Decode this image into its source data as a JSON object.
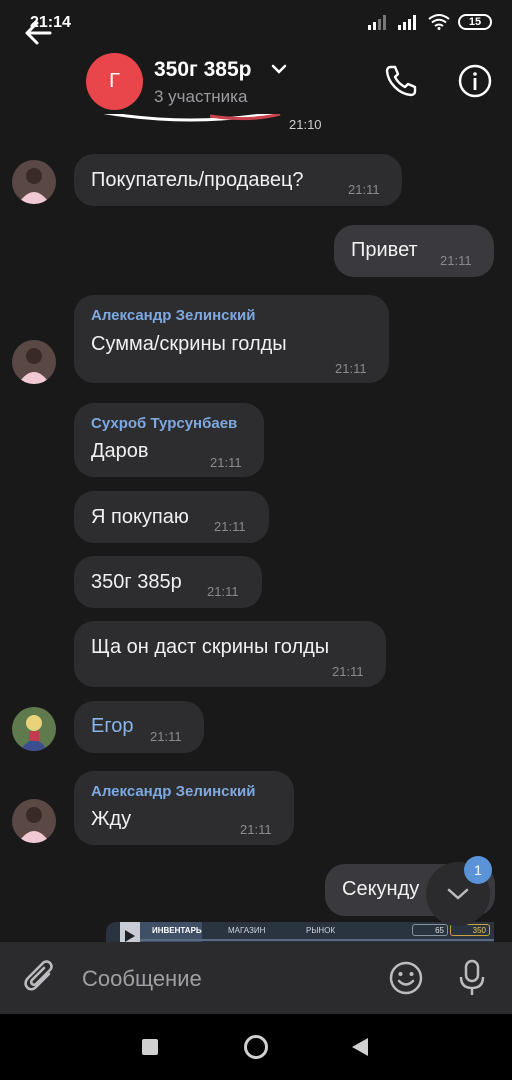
{
  "status_bar": {
    "time": "21:14",
    "battery": "15"
  },
  "header": {
    "avatar_letter": "Г",
    "title": "350г 385р",
    "subtitle": "3 участника"
  },
  "messages": [
    {
      "time": "21:10"
    },
    {
      "text": "Покупатель/продавец?",
      "time": "21:11"
    },
    {
      "text": "Привет",
      "time": "21:11"
    },
    {
      "sender": "Александр Зелинский",
      "text": "Сумма/скрины голды",
      "time": "21:11"
    },
    {
      "sender": "Сухроб Турсунбаев",
      "text": "Даров",
      "time": "21:11"
    },
    {
      "text": "Я покупаю",
      "time": "21:11"
    },
    {
      "text": "350г 385р",
      "time": "21:11"
    },
    {
      "text": "Ща он даст скрины голды",
      "time": "21:11"
    },
    {
      "text": "Егор",
      "time": "21:11"
    },
    {
      "sender": "Александр Зелинский",
      "text": "Жду",
      "time": "21:11"
    },
    {
      "text": "Секунду"
    }
  ],
  "game_strip": {
    "tabs": [
      "ИНВЕНТАРЬ",
      "МАГАЗИН",
      "РЫНОК"
    ],
    "badge_a": "65",
    "badge_b": "350"
  },
  "scroll_badge": "1",
  "composer": {
    "placeholder": "Сообщение"
  },
  "colors": {
    "accent": "#5b93d9",
    "sender_name": "#7ea9e0",
    "avatar_g": "#e9464c",
    "bubble": "#2d2d30"
  }
}
